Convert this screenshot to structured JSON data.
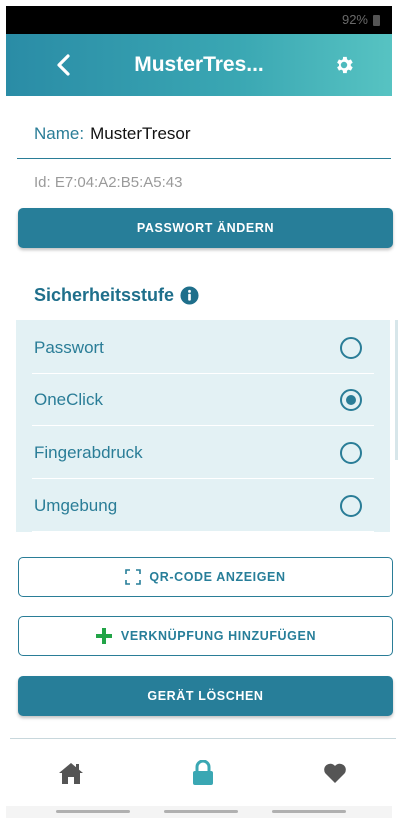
{
  "status_bar": {
    "battery": "92%"
  },
  "app_bar": {
    "title": "MusterTres...",
    "back_icon": "chevron-left-icon",
    "settings_icon": "gear-icon"
  },
  "device": {
    "name_label": "Name:",
    "name_value": "MusterTresor",
    "id_text": "Id: E7:04:A2:B5:A5:43"
  },
  "buttons": {
    "change_password": "PASSWORT ÄNDERN",
    "show_qr": "QR-CODE ANZEIGEN",
    "add_link": "VERKNÜPFUNG HINZUFÜGEN",
    "delete_device": "GERÄT LÖSCHEN"
  },
  "security": {
    "title": "Sicherheitsstufe",
    "options": [
      {
        "label": "Passwort",
        "selected": false
      },
      {
        "label": "OneClick",
        "selected": true
      },
      {
        "label": "Fingerabdruck",
        "selected": false
      },
      {
        "label": "Umgebung",
        "selected": false
      }
    ]
  },
  "bottom_nav": {
    "items": [
      {
        "icon": "home-icon",
        "active": false
      },
      {
        "icon": "lock-icon",
        "active": true
      },
      {
        "icon": "heart-icon",
        "active": false
      }
    ]
  },
  "colors": {
    "primary": "#277e99",
    "accent": "#3aa7b3",
    "options_bg": "#e3f1f4",
    "add_icon": "#22a447"
  }
}
